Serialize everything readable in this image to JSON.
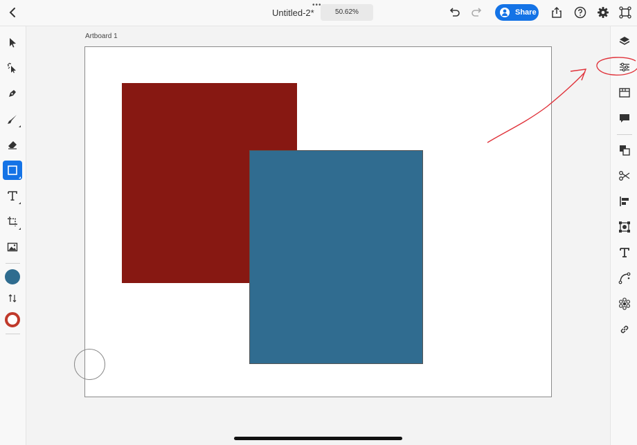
{
  "toolbar": {
    "title": "Untitled-2*",
    "zoom": "50.62%",
    "share_label": "Share"
  },
  "canvas": {
    "artboard_label": "Artboard 1"
  },
  "colors": {
    "accent": "#1473e6",
    "rect_red": "#871812",
    "rect_blue": "#306c90",
    "annotation": "#e0323a"
  },
  "left_tools": [
    "select-icon",
    "direct-select-icon",
    "pen-icon",
    "brush-icon",
    "eraser-icon",
    "rectangle-icon",
    "text-icon",
    "transform-icon",
    "image-icon"
  ],
  "right_panel": [
    "layers-icon",
    "properties-icon",
    "libraries-icon",
    "comments-icon",
    "arrange-icon",
    "scissors-icon",
    "align-icon",
    "path-icon",
    "type-icon",
    "curve-icon",
    "repeat-icon",
    "link-icon"
  ]
}
